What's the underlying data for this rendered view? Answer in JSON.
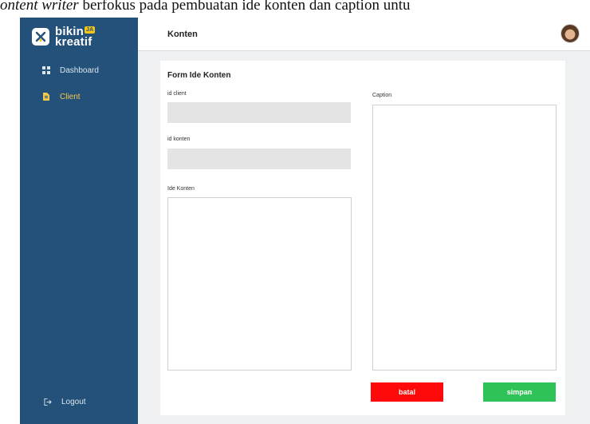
{
  "caption": {
    "italic_text": "ontent writer",
    "text": " berfokus pada pembuatan ide konten dan caption untu"
  },
  "brand": {
    "line1": "bikin",
    "line2": "kreatif",
    "badge": "JA",
    "colors": {
      "sidebar": "#245179",
      "accent": "#f2c94c"
    }
  },
  "sidebar": {
    "items": [
      {
        "label": "Dashboard",
        "icon": "grid-icon",
        "active": false
      },
      {
        "label": "Client",
        "icon": "document-icon",
        "active": true
      }
    ],
    "logout": {
      "label": "Logout",
      "icon": "logout-icon"
    }
  },
  "header": {
    "title": "Konten",
    "avatar_icon": "user-avatar"
  },
  "form": {
    "title": "Form Ide Konten",
    "id_client": {
      "label": "id client",
      "value": ""
    },
    "id_konten": {
      "label": "id konten",
      "value": ""
    },
    "ide_konten": {
      "label": "Ide Konten",
      "value": ""
    },
    "caption": {
      "label": "Caption",
      "value": ""
    },
    "batal_label": "batal",
    "simpan_label": "simpan",
    "colors": {
      "batal": "#ff0a0a",
      "simpan": "#2fc256"
    }
  }
}
